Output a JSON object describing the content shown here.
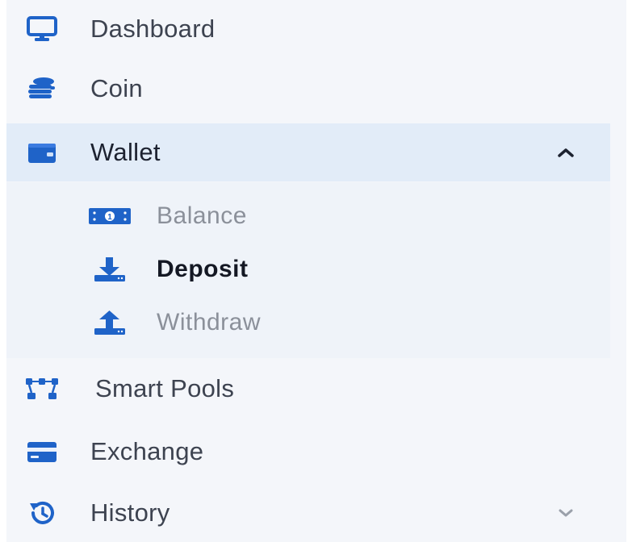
{
  "sidebar": {
    "accent_color": "#1f63c8",
    "items": [
      {
        "label": "Dashboard",
        "icon": "monitor-icon"
      },
      {
        "label": "Coin",
        "icon": "coins-icon"
      },
      {
        "label": "Wallet",
        "icon": "wallet-icon",
        "expanded": true,
        "active": true
      },
      {
        "label": "Smart Pools",
        "icon": "network-icon"
      },
      {
        "label": "Exchange",
        "icon": "credit-card-icon"
      },
      {
        "label": "History",
        "icon": "history-icon",
        "expanded": false
      }
    ],
    "wallet_submenu": [
      {
        "label": "Balance",
        "icon": "cash-icon"
      },
      {
        "label": "Deposit",
        "icon": "download-icon",
        "current": true
      },
      {
        "label": "Withdraw",
        "icon": "upload-icon"
      }
    ]
  }
}
